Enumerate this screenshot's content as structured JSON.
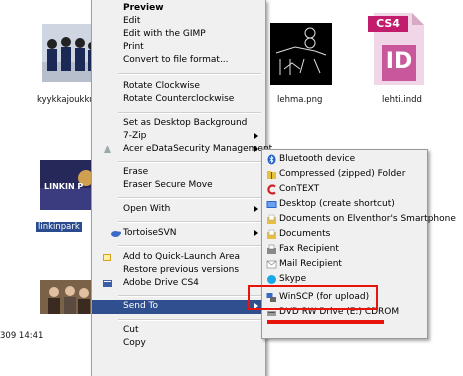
{
  "files": {
    "kyykka": "kyykkajoukku",
    "lehma": "lehma.png",
    "lehti": "lehti.indd",
    "linkinpark": "linkinpark",
    "timestamp": "309 14:41",
    "cs4_badge": "CS4",
    "id_badge": "ID"
  },
  "menu": {
    "preview": "Preview",
    "edit": "Edit",
    "edit_gimp": "Edit with the GIMP",
    "print": "Print",
    "convert": "Convert to file format...",
    "rotate_cw": "Rotate Clockwise",
    "rotate_ccw": "Rotate Counterclockwise",
    "set_bg": "Set as Desktop Background",
    "seven_zip": "7-Zip",
    "acer": "Acer eDataSecurity Management",
    "erase": "Erase",
    "erase_secure": "Eraser Secure Move",
    "open_with": "Open With",
    "tortoise": "TortoiseSVN",
    "quick_launch": "Add to Quick-Launch Area",
    "restore": "Restore previous versions",
    "adobe_drive": "Adobe Drive CS4",
    "send_to": "Send To",
    "cut": "Cut",
    "copy": "Copy"
  },
  "submenu": {
    "bluetooth": "Bluetooth device",
    "zip": "Compressed (zipped) Folder",
    "context": "ConTEXT",
    "desktop": "Desktop (create shortcut)",
    "docs_phone": "Documents on Elventhor's Smartphone",
    "documents": "Documents",
    "fax": "Fax Recipient",
    "mail": "Mail Recipient",
    "skype": "Skype",
    "winscp": "WinSCP (for upload)",
    "dvd": "DVD RW Drive (E:) CDROM"
  },
  "colors": {
    "highlight": "#2f4f8f",
    "annotation": "#e8140c"
  }
}
